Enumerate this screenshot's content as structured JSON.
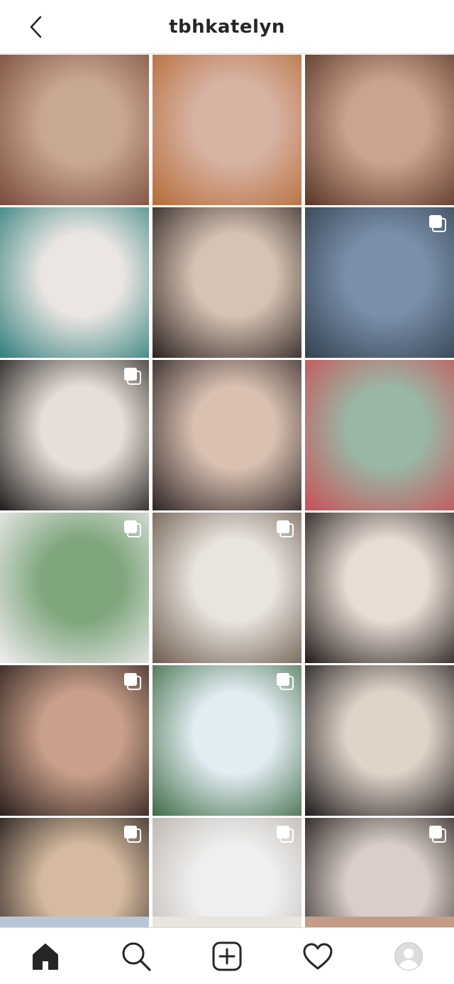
{
  "header": {
    "username": "tbhkatelyn",
    "back_icon": "chevron-left-icon"
  },
  "grid": {
    "rows": [
      [
        {
          "name": "post-closeup-portrait-brown-bob",
          "colors": [
            "#c9a893",
            "#7a4a3a"
          ],
          "multi": false
        },
        {
          "name": "post-orange-sweater-jeans",
          "colors": [
            "#d7b3a3",
            "#b66b37"
          ],
          "multi": false
        },
        {
          "name": "post-selfie-brown-hair",
          "colors": [
            "#caa48d",
            "#5a3426"
          ],
          "multi": false
        }
      ],
      [
        {
          "name": "post-bedroom-mirror-selfie",
          "colors": [
            "#ebe6e3",
            "#2f7f7c"
          ],
          "multi": false
        },
        {
          "name": "post-hand-on-chin-selfie",
          "colors": [
            "#d6c3b3",
            "#2a211f"
          ],
          "multi": false
        },
        {
          "name": "post-patio-orange-drink",
          "colors": [
            "#7a8faa",
            "#33414f"
          ],
          "multi": true
        }
      ],
      [
        {
          "name": "post-holding-skincare-bottle",
          "colors": [
            "#e7dfd7",
            "#1f1b1b"
          ],
          "multi": true
        },
        {
          "name": "post-car-selfie",
          "colors": [
            "#d9c0b1",
            "#2b2323"
          ],
          "multi": false
        },
        {
          "name": "post-two-friends-garden",
          "colors": [
            "#9ab6a4",
            "#c84f55"
          ],
          "multi": false
        }
      ],
      [
        {
          "name": "post-garden-white-outfit",
          "colors": [
            "#7fa67d",
            "#f2eef2"
          ],
          "multi": true
        },
        {
          "name": "post-circle-window-seated",
          "colors": [
            "#e9e4de",
            "#6b5a4c"
          ],
          "multi": true
        },
        {
          "name": "post-closeup-smile-selfie",
          "colors": [
            "#e8ddd4",
            "#221a19"
          ],
          "multi": false
        }
      ],
      [
        {
          "name": "post-orange-cardigan-selfie",
          "colors": [
            "#caa08b",
            "#2a1f1c"
          ],
          "multi": true
        },
        {
          "name": "post-snow-forest-overalls",
          "colors": [
            "#e2ecf3",
            "#3e6b43"
          ],
          "multi": true
        },
        {
          "name": "post-corset-wavy-hair",
          "colors": [
            "#e0d4c9",
            "#1e1a1b"
          ],
          "multi": false
        }
      ],
      [
        {
          "name": "post-car-smile-selfie",
          "colors": [
            "#d6ba9f",
            "#1b1717"
          ],
          "multi": true
        },
        {
          "name": "post-white-flowers-products",
          "colors": [
            "#efefef",
            "#b9b1aa"
          ],
          "multi": true
        },
        {
          "name": "post-black-top-wavy-hair",
          "colors": [
            "#dacfc8",
            "#1a1515"
          ],
          "multi": true
        }
      ]
    ],
    "peek_colors": [
      "#b8c7d8",
      "#e9e4de",
      "#c49c86"
    ]
  },
  "bottom_nav": {
    "items": [
      {
        "name": "home-icon",
        "active": true
      },
      {
        "name": "search-icon",
        "active": false
      },
      {
        "name": "new-post-icon",
        "active": false
      },
      {
        "name": "activity-heart-icon",
        "active": false
      },
      {
        "name": "profile-avatar",
        "active": false
      }
    ]
  }
}
